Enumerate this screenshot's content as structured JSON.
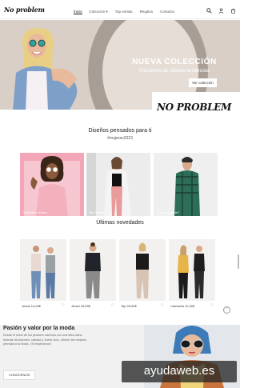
{
  "header": {
    "logo": "No problem",
    "nav": [
      "Inicio",
      "Colección ▾",
      "Top ventas",
      "Regalos",
      "Contacto"
    ],
    "icons": [
      "search-icon",
      "user-icon",
      "cart-icon"
    ]
  },
  "hero": {
    "title": "NUEVA COLECCIÓN",
    "subtitle": "Encuentra las últimas tendencias",
    "button": "Ver colección"
  },
  "stamp": {
    "text": "NO PROBLEM"
  },
  "designs": {
    "title": "Diseños pensados para ti",
    "hashtag": "#mujeres2023",
    "cards": [
      {
        "label": "Colección verano"
      },
      {
        "label": "Top Ventas"
      },
      {
        "label": "¿Qué regalarle?"
      }
    ]
  },
  "new_arrivals": {
    "title": "Últimas novedades",
    "products": [
      {
        "price": "Jeans 14,00€"
      },
      {
        "price": "Jersei 25,50€"
      },
      {
        "price": "Top 25,50€"
      },
      {
        "price": "Camiseta 12,00€"
      }
    ]
  },
  "bottom": {
    "title": "Pasión y valor por la moda",
    "text": "Desde el inicio de No problem nacimos con una idea clara: buenas vibraciones, calidad y, sobre todo, ofrecer las mejores prendas a la moda. ¡Te esperamos!",
    "button": "CONÓCENOS"
  },
  "watermark": {
    "text": "ayudaweb.es"
  },
  "colors": {
    "hero_bg": "#d9cfc6",
    "pink_card": "#f2a6b8",
    "dark": "#222222"
  }
}
